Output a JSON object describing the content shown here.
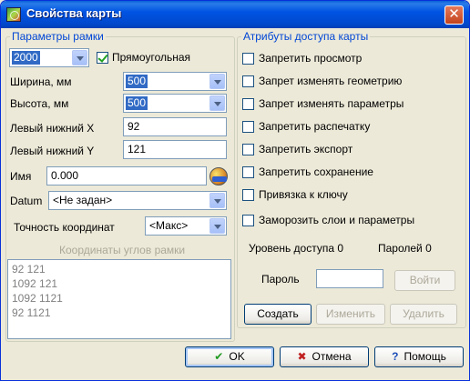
{
  "window": {
    "title": "Свойства карты",
    "close_glyph": "✕"
  },
  "frame": {
    "legend": "Параметры рамки",
    "scale_value": "2000",
    "rectangular_label": "Прямоугольная",
    "rectangular_checked": true,
    "width_label": "Ширина, мм",
    "width_value": "500",
    "height_label": "Высота, мм",
    "height_value": "500",
    "lower_left_x_label": "Левый нижний X",
    "lower_left_x_value": "92",
    "lower_left_y_label": "Левый нижний Y",
    "lower_left_y_value": "121",
    "name_label": "Имя",
    "name_value": "0.000",
    "datum_label": "Datum",
    "datum_value": "<Не задан>",
    "precision_label": "Точность координат",
    "precision_value": "<Макс>",
    "corners_label": "Координаты углов рамки",
    "corners": [
      "92 121",
      "1092 121",
      "1092 1121",
      "92 1121"
    ]
  },
  "access": {
    "legend": "Атрибуты доступа карты",
    "options": [
      {
        "label": "Запретить просмотр",
        "checked": false
      },
      {
        "label": "Запрет изменять геометрию",
        "checked": false
      },
      {
        "label": "Запрет изменять параметры",
        "checked": false
      },
      {
        "label": "Запретить распечатку",
        "checked": false
      },
      {
        "label": "Запретить экспорт",
        "checked": false
      },
      {
        "label": "Запретить сохранение",
        "checked": false
      },
      {
        "label": "Привязка к ключу",
        "checked": false
      },
      {
        "label": "Заморозить слои и параметры",
        "checked": false
      }
    ],
    "access_level": "Уровень доступа 0",
    "passwords_count": "Паролей 0",
    "password_label": "Пароль",
    "password_value": "",
    "login_label": "Войти",
    "create_label": "Создать",
    "change_label": "Изменить",
    "delete_label": "Удалить"
  },
  "footer": {
    "ok_label": "OK",
    "cancel_label": "Отмена",
    "help_label": "Помощь",
    "ok_icon": "✔",
    "cancel_icon": "✖",
    "help_icon": "?"
  }
}
